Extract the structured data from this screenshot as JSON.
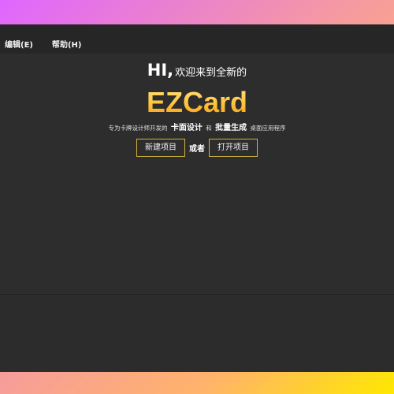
{
  "menubar": {
    "items": [
      {
        "label": "编辑(E)"
      },
      {
        "label": "帮助(H)"
      }
    ]
  },
  "welcome": {
    "greeting_hi": "HI,",
    "greeting_rest": "欢迎来到全新的",
    "app_name": "EZCard",
    "tagline_prefix": "专为卡牌设计师开发的",
    "tagline_feature_1": "卡面设计",
    "tagline_and": "和",
    "tagline_feature_2": "批量生成",
    "tagline_suffix": "桌面应用程序"
  },
  "actions": {
    "new_project_label": "新建项目",
    "or_label": "或者",
    "open_project_label": "打开项目"
  },
  "colors": {
    "accent_gold": "#ffc23b",
    "button_border": "#d4b43a",
    "window_bg": "#2f2f2f",
    "menubar_bg": "#262626"
  }
}
